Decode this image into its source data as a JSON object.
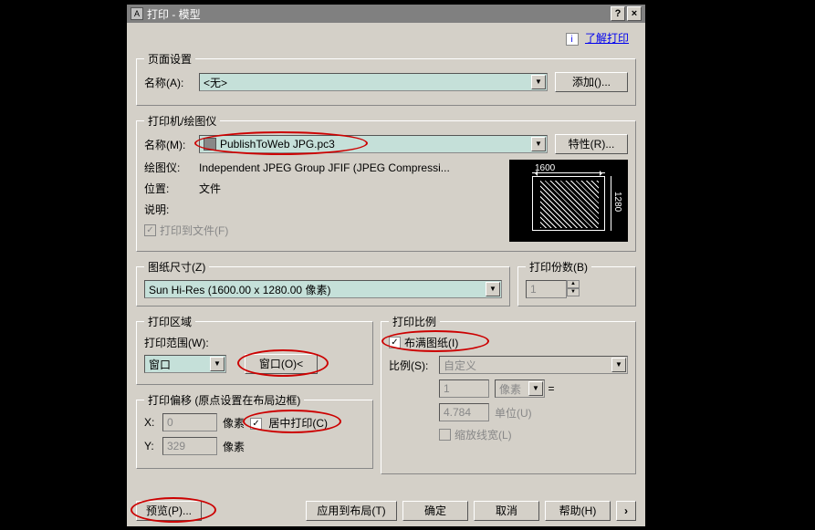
{
  "title": "打印 - 模型",
  "help": {
    "label": "了解打印",
    "icon": "i"
  },
  "pageSetup": {
    "legend": "页面设置",
    "nameLabel": "名称(A):",
    "nameValue": "<无>",
    "addBtn": "添加()..."
  },
  "printer": {
    "legend": "打印机/绘图仪",
    "nameLabel": "名称(M):",
    "nameValue": "PublishToWeb JPG.pc3",
    "propsBtn": "特性(R)...",
    "plotterLabel": "绘图仪:",
    "plotterValue": "Independent JPEG Group JFIF (JPEG Compressi...",
    "locationLabel": "位置:",
    "locationValue": "文件",
    "descLabel": "说明:",
    "descValue": "",
    "printToFile": "打印到文件(F)",
    "preview": {
      "width": "1600",
      "height": "1280"
    }
  },
  "paperSize": {
    "legend": "图纸尺寸(Z)",
    "value": "Sun Hi-Res (1600.00 x 1280.00 像素)"
  },
  "copies": {
    "legend": "打印份数(B)",
    "value": "1"
  },
  "area": {
    "legend": "打印区域",
    "rangeLabel": "打印范围(W):",
    "rangeValue": "窗口",
    "windowBtn": "窗口(O)<"
  },
  "offset": {
    "legend": "打印偏移 (原点设置在布局边框)",
    "xLabel": "X:",
    "xValue": "0",
    "xUnit": "像素",
    "yLabel": "Y:",
    "yValue": "329",
    "yUnit": "像素",
    "centerLabel": "居中打印(C)"
  },
  "scale": {
    "legend": "打印比例",
    "fitLabel": "布满图纸(I)",
    "ratioLabel": "比例(S):",
    "ratioValue": "自定义",
    "num": "1",
    "numUnit": "像素",
    "den": "4.784",
    "denUnit": "单位(U)",
    "lwLabel": "缩放线宽(L)"
  },
  "buttons": {
    "preview": "预览(P)...",
    "applyLayout": "应用到布局(T)",
    "ok": "确定",
    "cancel": "取消",
    "help": "帮助(H)"
  }
}
